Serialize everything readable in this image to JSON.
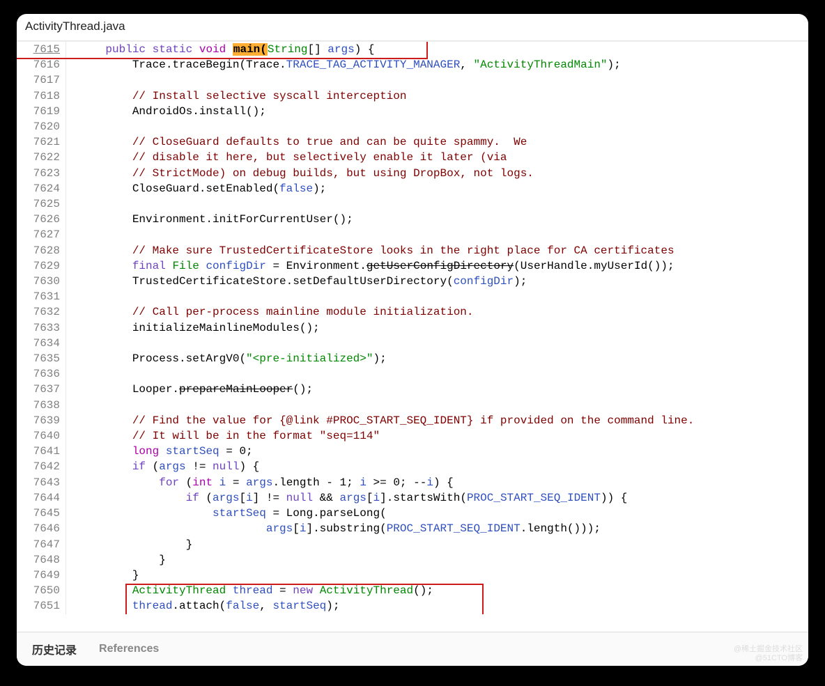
{
  "file": {
    "name": "ActivityThread.java"
  },
  "highlight": {
    "wordClass": "hl-main"
  },
  "code": {
    "startLine": 7615,
    "lines": [
      {
        "indent": 4,
        "html": "<span class='tok-kw'>public</span> <span class='tok-kw'>static</span> <span class='tok-prim'>void</span> <span class='hl-main'>main(</span><span class='tok-type'>String</span>[] <span class='tok-param'>args</span>) {"
      },
      {
        "indent": 8,
        "html": "Trace.traceBegin(Trace.<span class='tok-param'>TRACE_TAG_ACTIVITY_MANAGER</span>, <span class='tok-str'>\"ActivityThreadMain\"</span>);"
      },
      {
        "indent": 0,
        "html": ""
      },
      {
        "indent": 8,
        "html": "<span class='tok-cmt'>// Install selective syscall interception</span>"
      },
      {
        "indent": 8,
        "html": "AndroidOs.install();"
      },
      {
        "indent": 0,
        "html": ""
      },
      {
        "indent": 8,
        "html": "<span class='tok-cmt'>// CloseGuard defaults to true and can be quite spammy.  We</span>"
      },
      {
        "indent": 8,
        "html": "<span class='tok-cmt'>// disable it here, but selectively enable it later (via</span>"
      },
      {
        "indent": 8,
        "html": "<span class='tok-cmt'>// StrictMode) on debug builds, but using DropBox, not logs.</span>"
      },
      {
        "indent": 8,
        "html": "CloseGuard.setEnabled(<span class='tok-bool'>false</span>);"
      },
      {
        "indent": 0,
        "html": ""
      },
      {
        "indent": 8,
        "html": "Environment.initForCurrentUser();"
      },
      {
        "indent": 0,
        "html": ""
      },
      {
        "indent": 8,
        "html": "<span class='tok-cmt'>// Make sure TrustedCertificateStore looks in the right place for CA certificates</span>"
      },
      {
        "indent": 8,
        "html": "<span class='tok-kw'>final</span> <span class='tok-type'>File</span> <span class='tok-param'>configDir</span> = Environment.<span class='strike'>getUserConfigDirectory</span>(UserHandle.myUserId());"
      },
      {
        "indent": 8,
        "html": "TrustedCertificateStore.setDefaultUserDirectory(<span class='tok-param'>configDir</span>);"
      },
      {
        "indent": 0,
        "html": ""
      },
      {
        "indent": 8,
        "html": "<span class='tok-cmt'>// Call per-process mainline module initialization.</span>"
      },
      {
        "indent": 8,
        "html": "initializeMainlineModules();"
      },
      {
        "indent": 0,
        "html": ""
      },
      {
        "indent": 8,
        "html": "Process.setArgV0(<span class='tok-str'>\"&lt;pre-initialized&gt;\"</span>);"
      },
      {
        "indent": 0,
        "html": ""
      },
      {
        "indent": 8,
        "html": "Looper.<span class='strike'>prepareMainLooper</span>();"
      },
      {
        "indent": 0,
        "html": ""
      },
      {
        "indent": 8,
        "html": "<span class='tok-cmt'>// Find the value for {@link #PROC_START_SEQ_IDENT} if provided on the command line.</span>"
      },
      {
        "indent": 8,
        "html": "<span class='tok-cmt'>// It will be in the format \"seq=114\"</span>"
      },
      {
        "indent": 8,
        "html": "<span class='tok-prim'>long</span> <span class='tok-param'>startSeq</span> = 0;"
      },
      {
        "indent": 8,
        "html": "<span class='tok-kw'>if</span> (<span class='tok-param'>args</span> != <span class='tok-kw'>null</span>) {"
      },
      {
        "indent": 12,
        "html": "<span class='tok-kw'>for</span> (<span class='tok-prim'>int</span> <span class='tok-param'>i</span> = <span class='tok-param'>args</span>.length - 1; <span class='tok-param'>i</span> &gt;= 0; --<span class='tok-param'>i</span>) {"
      },
      {
        "indent": 16,
        "html": "<span class='tok-kw'>if</span> (<span class='tok-param'>args</span>[<span class='tok-param'>i</span>] != <span class='tok-kw'>null</span> &amp;&amp; <span class='tok-param'>args</span>[<span class='tok-param'>i</span>].startsWith(<span class='tok-param'>PROC_START_SEQ_IDENT</span>)) {"
      },
      {
        "indent": 20,
        "html": "<span class='tok-param'>startSeq</span> = Long.parseLong("
      },
      {
        "indent": 28,
        "html": "<span class='tok-param'>args</span>[<span class='tok-param'>i</span>].substring(<span class='tok-param'>PROC_START_SEQ_IDENT</span>.length()));"
      },
      {
        "indent": 16,
        "html": "}"
      },
      {
        "indent": 12,
        "html": "}"
      },
      {
        "indent": 8,
        "html": "}"
      },
      {
        "indent": 8,
        "html": "<span class='tok-type'>ActivityThread</span> <span class='tok-param'>thread</span> = <span class='tok-kw'>new</span> <span class='tok-def'>ActivityThread</span>();"
      },
      {
        "indent": 8,
        "html": "<span class='tok-param'>thread</span>.attach(<span class='tok-bool'>false</span>, <span class='tok-param'>startSeq</span>);"
      }
    ]
  },
  "footer": {
    "history_label": "历史记录",
    "references_label": "References"
  },
  "watermark": {
    "line1": "@稀土掘金技术社区",
    "line2": "@51CTO博客"
  },
  "annotations": {
    "box1": "file-title-and-first-line-box",
    "box2": "activitythread-attach-box"
  }
}
